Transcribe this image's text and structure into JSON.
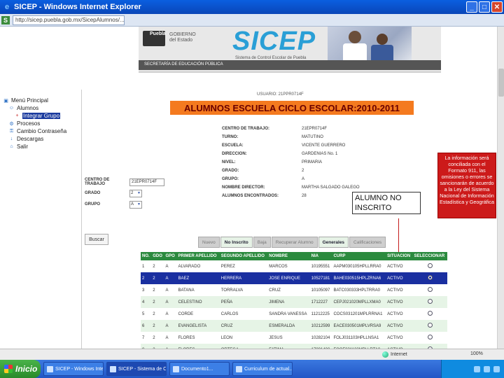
{
  "window": {
    "title": "SICEP - Windows Internet Explorer",
    "address": "http://sicep.puebla.gob.mx/SicepAlumnos/..."
  },
  "banner": {
    "puebla_label": "Puebla",
    "gob_label": "GOBIERNO del Estado",
    "app_name": "SICEP",
    "app_subtitle": "Sistema de Control Escolar de Puebla",
    "secretaria": "SECRETARÍA DE EDUCACIÓN PÚBLICA"
  },
  "menu": {
    "items": [
      {
        "label": "Menú Principal",
        "level": 0,
        "icon": "folder-icon"
      },
      {
        "label": "Alumnos",
        "level": 1,
        "icon": "users-icon"
      },
      {
        "label": "Integrar Grupo",
        "level": 2,
        "icon": "plus-icon",
        "active": true
      },
      {
        "label": "Procesos",
        "level": 1,
        "icon": "gears-icon"
      },
      {
        "label": "Cambio Contraseña",
        "level": 1,
        "icon": "key-icon"
      },
      {
        "label": "Descargas",
        "level": 1,
        "icon": "download-icon"
      },
      {
        "label": "Salir",
        "level": 1,
        "icon": "door-icon"
      }
    ]
  },
  "page": {
    "user_line": "USUARIO: 21PPR0714F",
    "title": "ALUMNOS ESCUELA CICLO ESCOLAR:2010-2011"
  },
  "school_info": [
    {
      "k": "CENTRO DE TRABAJO:",
      "v": "21EPR0714F"
    },
    {
      "k": "TURNO:",
      "v": "MATUTINO"
    },
    {
      "k": "ESCUELA:",
      "v": "VICENTE GUERRERO"
    },
    {
      "k": "DIRECCION:",
      "v": "GARDENIAS No. 1"
    },
    {
      "k": "NIVEL:",
      "v": "PRIMARIA"
    },
    {
      "k": "GRADO:",
      "v": "2"
    },
    {
      "k": "GRUPO:",
      "v": "A"
    },
    {
      "k": "NOMBRE DIRECTOR:",
      "v": "MARTHA SALGADO GALEGO"
    },
    {
      "k": "ALUMNOS ENCONTRADOS:",
      "v": "28"
    }
  ],
  "filters": {
    "centro_label": "CENTRO DE TRABAJO",
    "centro_value": "21EPR0714F",
    "grado_label": "GRADO",
    "grado_value": "2",
    "grupo_label": "GRUPO",
    "grupo_value": "A"
  },
  "legal_notice": "La información será conciliada con el Formato 911, las omisiones o errores se sancionarán de acuerdo a la Ley del Sistema Nacional de Información Estadística y Geográfica",
  "callout": "ALUMNO NO INSCRITO",
  "search_button": "Buscar",
  "tabs": [
    {
      "label": "Nuevo",
      "on": false
    },
    {
      "label": "No Inscrito",
      "on": true
    },
    {
      "label": "Baja",
      "on": false
    },
    {
      "label": "Recuperar Alumno",
      "on": false
    },
    {
      "label": "Generales",
      "on": true
    },
    {
      "label": "Calificaciones",
      "on": false
    }
  ],
  "table": {
    "headers": [
      "NO.",
      "GDO",
      "GPO",
      "PRIMER APELLIDO",
      "SEGUNDO APELLIDO",
      "NOMBRE",
      "NIA",
      "CURP",
      "SITUACION",
      "SELECCIONAR"
    ],
    "rows": [
      {
        "no": "1",
        "gdo": "2",
        "gpo": "A",
        "ap1": "ALVARADO",
        "ap2": "PEREZ",
        "nombre": "MARCOS",
        "nia": "10195551",
        "curp": "AAPM030105HPLLRRA0",
        "sit": "ACTIVO",
        "selected": false
      },
      {
        "no": "2",
        "gdo": "2",
        "gpo": "A",
        "ap1": "BAEZ",
        "ap2": "HERRERA",
        "nombre": "JOSE ENRIQUE",
        "nia": "10527181",
        "curp": "BAHE030515HPLZRNA6",
        "sit": "ACTIVO",
        "selected": true
      },
      {
        "no": "3",
        "gdo": "2",
        "gpo": "A",
        "ap1": "BATANA",
        "ap2": "TORRALVA",
        "nombre": "CRUZ",
        "nia": "10105097",
        "curp": "BATC030333HPLTRRA0",
        "sit": "ACTIVO",
        "selected": false
      },
      {
        "no": "4",
        "gdo": "2",
        "gpo": "A",
        "ap1": "CELESTINO",
        "ap2": "PEÑA",
        "nombre": "JIMENA",
        "nia": "1712227",
        "curp": "CEPJ021020MPLLXMA0",
        "sit": "ACTIVO",
        "selected": false
      },
      {
        "no": "5",
        "gdo": "2",
        "gpo": "A",
        "ap1": "CORDE",
        "ap2": "CARLOS",
        "nombre": "SANDRA VANESSA",
        "nia": "11212225",
        "curp": "COCS031201MPLRRNA1",
        "sit": "ACTIVO",
        "selected": false
      },
      {
        "no": "6",
        "gdo": "2",
        "gpo": "A",
        "ap1": "EVANGELISTA",
        "ap2": "CRUZ",
        "nombre": "ESMERALDA",
        "nia": "10212599",
        "curp": "EACE030501MPLVRSA9",
        "sit": "ACTIVO",
        "selected": false
      },
      {
        "no": "7",
        "gdo": "2",
        "gpo": "A",
        "ap1": "FLORES",
        "ap2": "LEON",
        "nombre": "JESUS",
        "nia": "10282104",
        "curp": "FOLJ031103HPLLNSA1",
        "sit": "ACTIVO",
        "selected": false
      },
      {
        "no": "8",
        "gdo": "2",
        "gpo": "A",
        "ap1": "FLORES",
        "ap2": "ORTEGA",
        "nombre": "FATIMA",
        "nia": "17001400",
        "curp": "FOOF031123MPLLRTA0",
        "sit": "ACTIVO",
        "selected": false
      },
      {
        "no": "9",
        "gdo": "2",
        "gpo": "A",
        "ap1": "FLORES",
        "ap2": "SANCHEZ",
        "nombre": "MARTIN",
        "nia": "1706795",
        "curp": "FOSM030601HPLLNRA0",
        "sit": "ACTIVO",
        "selected": false
      }
    ]
  },
  "status": {
    "internet": "Internet",
    "zoom": "100%"
  },
  "taskbar": {
    "start": "Inicio",
    "tasks": [
      {
        "label": "SICEP - Windows Inte...",
        "active": false
      },
      {
        "label": "SICEP - Sistema de Con...",
        "active": true
      },
      {
        "label": "Documento1...",
        "active": false
      },
      {
        "label": "Curriculum de actual...",
        "active": false
      }
    ]
  }
}
